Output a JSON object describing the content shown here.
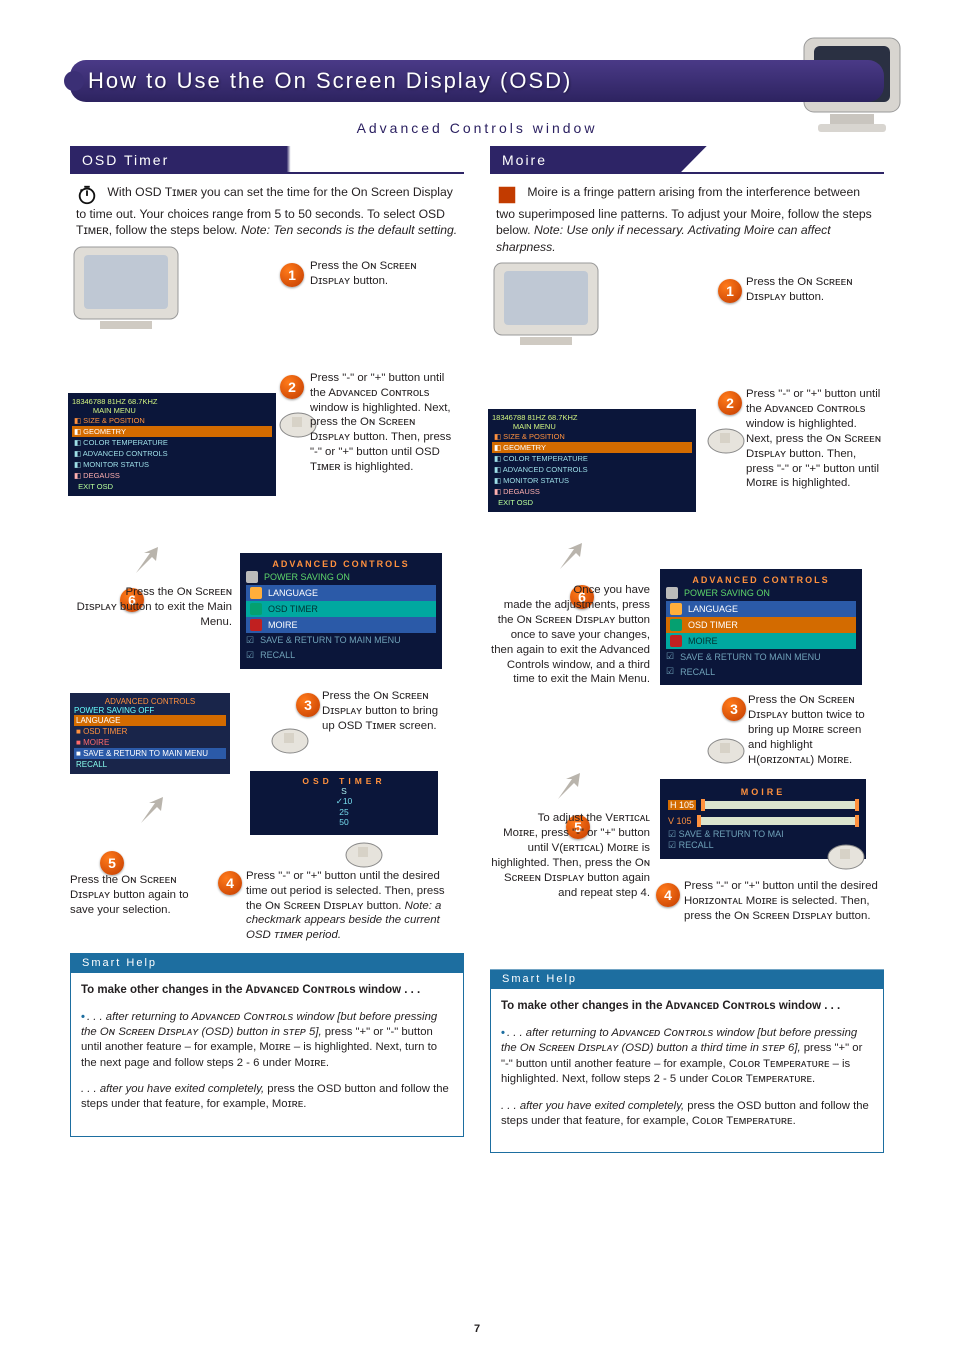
{
  "header": {
    "title": "How to Use the On Screen Display (OSD)",
    "subtitle": "Advanced Controls window"
  },
  "page_number": "7",
  "left": {
    "title": "OSD Timer",
    "intro": "With OSD Tɪᴍᴇʀ you can set the time for the On Screen Display to time out. Your choices range from 5 to 50 seconds. To select OSD Tɪᴍᴇʀ, follow the steps below. ",
    "intro_note": "Note: Ten seconds is the default setting.",
    "step1": "Press the Oɴ Sᴄʀᴇᴇɴ Dɪsᴘʟᴀʏ button.",
    "step2": "Press \"-\" or \"+\" button until the Aᴅᴠᴀɴᴄᴇᴅ Cᴏɴᴛʀᴏʟs window is highlighted. Next, press the Oɴ Sᴄʀᴇᴇɴ Dɪsᴘʟᴀʏ button. Then, press \"-\" or \"+\" button until OSD Tɪᴍᴇʀ is highlighted.",
    "step3": "Press the Oɴ Sᴄʀᴇᴇɴ Dɪsᴘʟᴀʏ button to bring up OSD Tɪᴍᴇʀ screen.",
    "step4": "Press \"-\" or \"+\" button until the desired time out period is selected. Then, press the Oɴ Sᴄʀᴇᴇɴ Dɪsᴘʟᴀʏ button. ",
    "step4_note": "Note: a checkmark appears beside the current OSD ᴛɪᴍᴇʀ period.",
    "step5": "Press the Oɴ Sᴄʀᴇᴇɴ Dɪsᴘʟᴀʏ button again to save your selection.",
    "step6": "Press the Oɴ Sᴄʀᴇᴇɴ Dɪsᴘʟᴀʏ button to exit the Main Menu.",
    "adv_menu": {
      "title": "ADVANCED CONTROLS",
      "power": "POWER SAVING ON",
      "items": [
        "LANGUAGE",
        "OSD TIMER",
        "MOIRE",
        "SAVE & RETURN TO MAIN MENU",
        "RECALL"
      ]
    },
    "osd_timer_box": {
      "title": "OSD TIMER",
      "unit": "S",
      "opts": [
        "✓10",
        "25",
        "50"
      ]
    },
    "sub_menu": {
      "title": "ADVANCED CONTROLS",
      "sub": "POWER SAVING OFF",
      "items": [
        "LANGUAGE",
        "OSD TIMER",
        "MOIRE",
        "SAVE & RETURN TO MAIN MENU",
        "RECALL"
      ]
    },
    "smart": {
      "title": "Smart Help",
      "heading": "To make other changes in the Aᴅᴠᴀɴᴄᴇᴅ Cᴏɴᴛʀᴏʟs window . . .",
      "p1a": ". . . after returning to Aᴅᴠᴀɴᴄᴇᴅ Cᴏɴᴛʀᴏʟs window [but before pressing the Oɴ Sᴄʀᴇᴇɴ Dɪsᴘʟᴀʏ (OSD) button in sᴛᴇᴘ 5],",
      "p1b": " press \"+\" or \"-\" button until another feature – for example, Mᴏɪʀᴇ – is highlighted. Next, turn to the next page and follow steps 2 - 6 under Mᴏɪʀᴇ.",
      "p2a": ". . . after you have exited completely,",
      "p2b": " press the OSD button and follow the steps under that feature, for example, Mᴏɪʀᴇ."
    }
  },
  "right": {
    "title": "Moire",
    "intro": "Moire is a fringe pattern arising from the interference between two superimposed line patterns. To adjust your Moire, follow the steps below. ",
    "intro_note": "Note: Use only if necessary. Activating Moire can affect sharpness.",
    "step1": "Press the Oɴ Sᴄʀᴇᴇɴ Dɪsᴘʟᴀʏ button.",
    "step2": "Press \"-\" or \"+\" button until the Aᴅᴠᴀɴᴄᴇᴅ Cᴏɴᴛʀᴏʟs window is highlighted. Next, press the Oɴ Sᴄʀᴇᴇɴ Dɪsᴘʟᴀʏ button. Then, press \"-\" or \"+\" button until Mᴏɪʀᴇ is highlighted.",
    "step3": "Press the Oɴ Sᴄʀᴇᴇɴ Dɪsᴘʟᴀʏ button twice to bring up Mᴏɪʀᴇ screen and highlight H(ᴏʀɪᴢᴏɴᴛᴀʟ) Mᴏɪʀᴇ.",
    "step4": "Press \"-\" or \"+\" button until the desired Hᴏʀɪᴢᴏɴᴛᴀʟ Mᴏɪʀᴇ is selected. Then, press the Oɴ Sᴄʀᴇᴇɴ Dɪsᴘʟᴀʏ button.",
    "step5": "To adjust the Vᴇʀᴛɪᴄᴀʟ Mᴏɪʀᴇ, press \"-\" or \"+\" button until V(ᴇʀᴛɪᴄᴀʟ) Mᴏɪʀᴇ is highlighted. Then, press the Oɴ Sᴄʀᴇᴇɴ Dɪsᴘʟᴀʏ button again and repeat step 4.",
    "step6": "Once you have made the adjustments, press the Oɴ Sᴄʀᴇᴇɴ Dɪsᴘʟᴀʏ button once to save your changes, then again to exit the Advanced Controls window, and a third time to exit the Main Menu.",
    "adv_menu": {
      "title": "ADVANCED CONTROLS",
      "power": "POWER SAVING ON",
      "items": [
        "LANGUAGE",
        "OSD TIMER",
        "MOIRE",
        "SAVE & RETURN TO MAIN MENU",
        "RECALL"
      ]
    },
    "moire_box": {
      "title": "MOIRE",
      "rows": [
        "H 105",
        "V 105"
      ],
      "foot": [
        "SAVE & RETURN TO MAI",
        "RECALL"
      ]
    },
    "smart": {
      "title": "Smart Help",
      "heading": "To make other changes in the Aᴅᴠᴀɴᴄᴇᴅ Cᴏɴᴛʀᴏʟs window . . .",
      "p1a": ". . . after returning to Aᴅᴠᴀɴᴄᴇᴅ Cᴏɴᴛʀᴏʟs window [but before pressing the Oɴ Sᴄʀᴇᴇɴ Dɪsᴘʟᴀʏ (OSD) button a third time in sᴛᴇᴘ 6],",
      "p1b": " press \"+\" or \"-\" button until another feature – for example, Cᴏʟᴏʀ Tᴇᴍᴘᴇʀᴀᴛᴜʀᴇ – is highlighted. Next, follow steps 2 - 5 under Cᴏʟᴏʀ Tᴇᴍᴘᴇʀᴀᴛᴜʀᴇ.",
      "p2a": ". . . after you have exited completely,",
      "p2b": " press the OSD button and follow the steps under that feature, for example, Cᴏʟᴏʀ Tᴇᴍᴘᴇʀᴀᴛᴜʀᴇ."
    }
  }
}
